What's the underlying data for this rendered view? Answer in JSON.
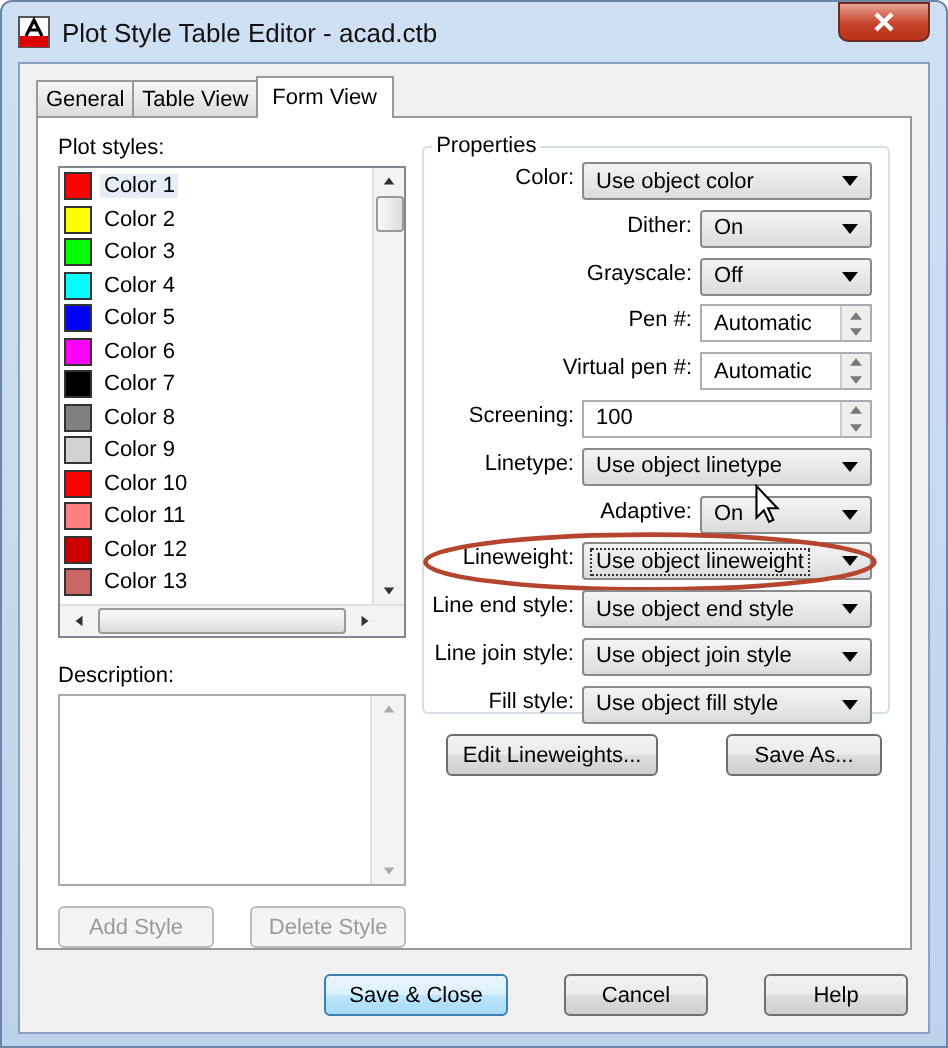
{
  "window": {
    "title": "Plot Style Table Editor - acad.ctb"
  },
  "tabs": [
    {
      "label": "General",
      "selected": false
    },
    {
      "label": "Table View",
      "selected": false
    },
    {
      "label": "Form View",
      "selected": true
    }
  ],
  "plot_styles": {
    "label": "Plot styles:",
    "items": [
      {
        "name": "Color 1",
        "color": "#ff0000",
        "selected": true
      },
      {
        "name": "Color 2",
        "color": "#ffff00",
        "selected": false
      },
      {
        "name": "Color 3",
        "color": "#00ff00",
        "selected": false
      },
      {
        "name": "Color 4",
        "color": "#00ffff",
        "selected": false
      },
      {
        "name": "Color 5",
        "color": "#0000ff",
        "selected": false
      },
      {
        "name": "Color 6",
        "color": "#ff00ff",
        "selected": false
      },
      {
        "name": "Color 7",
        "color": "#000000",
        "selected": false
      },
      {
        "name": "Color 8",
        "color": "#808080",
        "selected": false
      },
      {
        "name": "Color 9",
        "color": "#d3d3d3",
        "selected": false
      },
      {
        "name": "Color 10",
        "color": "#ff0000",
        "selected": false
      },
      {
        "name": "Color 11",
        "color": "#ff7f7f",
        "selected": false
      },
      {
        "name": "Color 12",
        "color": "#cc0000",
        "selected": false
      },
      {
        "name": "Color 13",
        "color": "#cc6666",
        "selected": false
      }
    ]
  },
  "description": {
    "label": "Description:"
  },
  "style_buttons": [
    {
      "label": "Add Style",
      "disabled": true
    },
    {
      "label": "Delete Style",
      "disabled": true
    }
  ],
  "properties": {
    "title": "Properties",
    "rows": [
      {
        "label": "Color:",
        "value": "Use object color",
        "kind": "combo",
        "highlighted": false
      },
      {
        "label": "Dither:",
        "value": "On",
        "kind": "choice",
        "highlighted": false
      },
      {
        "label": "Grayscale:",
        "value": "Off",
        "kind": "choice",
        "highlighted": false
      },
      {
        "label": "Pen #:",
        "value": "Automatic",
        "kind": "spin",
        "highlighted": false
      },
      {
        "label": "Virtual pen #:",
        "value": "Automatic",
        "kind": "spin",
        "highlighted": false
      },
      {
        "label": "Screening:",
        "value": "100",
        "kind": "number",
        "highlighted": false
      },
      {
        "label": "Linetype:",
        "value": "Use object linetype",
        "kind": "combo",
        "highlighted": false
      },
      {
        "label": "Adaptive:",
        "value": "On",
        "kind": "choice",
        "highlighted": false
      },
      {
        "label": "Lineweight:",
        "value": "Use object lineweight",
        "kind": "combo",
        "highlighted": true
      },
      {
        "label": "Line end style:",
        "value": "Use object end style",
        "kind": "combo",
        "highlighted": false
      },
      {
        "label": "Line join style:",
        "value": "Use object join style",
        "kind": "combo",
        "highlighted": false
      },
      {
        "label": "Fill style:",
        "value": "Use object fill style",
        "kind": "combo",
        "highlighted": false
      }
    ]
  },
  "property_buttons": [
    "Edit Lineweights...",
    "Save As..."
  ],
  "dialog_buttons": [
    {
      "label": "Save & Close",
      "default": true
    },
    {
      "label": "Cancel",
      "default": false
    },
    {
      "label": "Help",
      "default": false
    }
  ]
}
